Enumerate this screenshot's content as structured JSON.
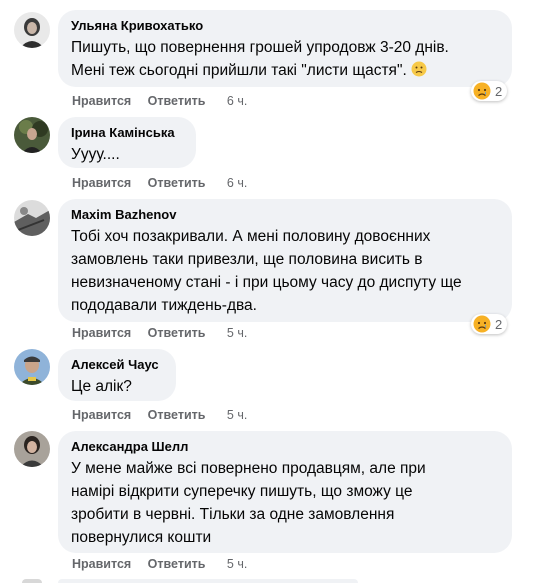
{
  "actions": {
    "like": "Нравится",
    "reply": "Ответить"
  },
  "comments": [
    {
      "name": "Ульяна Кривохатько",
      "text": "Пишуть, що повернення грошей упродовж 3-20 днів.\nМені теж сьогодні прийшли такі \"листи щастя\". ",
      "emoji": "confused-face-icon",
      "time": "6 ч.",
      "reaction_count": "2",
      "reaction_icon": "sad-face-icon"
    },
    {
      "name": "Ірина Камінська",
      "text": "Уууу....",
      "time": "6 ч."
    },
    {
      "name": "Maxim Bazhenov",
      "text": "Тобі хоч позакривали. А мені половину довоєнних\nзамовлень таки привезли, ще половина висить в\nневизначеному стані - і при цьому часу до диспуту ще\nпододавали тиждень-два.",
      "time": "5 ч.",
      "reaction_count": "2",
      "reaction_icon": "sad-face-icon"
    },
    {
      "name": "Алексей Чаус",
      "text": "Це алік?",
      "time": "5 ч."
    },
    {
      "name": "Александра Шелл",
      "text": "У мене майже всі повернено продавцям, але при\nнамірі відкрити суперечку пишуть, що зможу це\nзробити в червні. Тільки за одне замовлення\nповернулися кошти",
      "time": "5 ч."
    }
  ],
  "colors": {
    "bubble": "#f0f2f5",
    "meta_text": "#65676b",
    "text": "#050505",
    "emoji_yellow": "#f7b125"
  }
}
